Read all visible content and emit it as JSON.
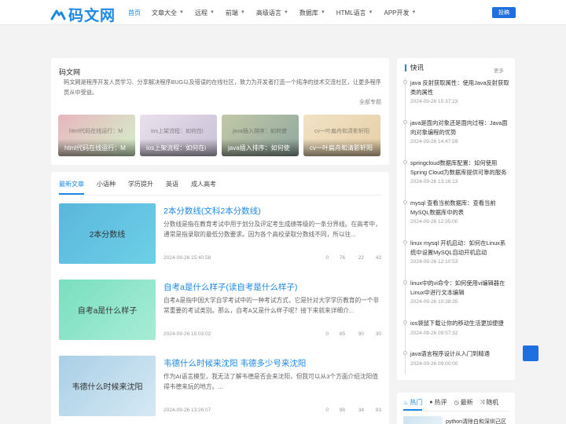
{
  "header": {
    "logo_text": "码文网",
    "nav": [
      {
        "label": "首页",
        "active": true,
        "dropdown": false
      },
      {
        "label": "文章大全",
        "active": false,
        "dropdown": true
      },
      {
        "label": "远程",
        "active": false,
        "dropdown": true
      },
      {
        "label": "前端",
        "active": false,
        "dropdown": true
      },
      {
        "label": "高级语言",
        "active": false,
        "dropdown": true
      },
      {
        "label": "数据库",
        "active": false,
        "dropdown": true
      },
      {
        "label": "HTML语言",
        "active": false,
        "dropdown": true
      },
      {
        "label": "APP开发",
        "active": false,
        "dropdown": true
      }
    ],
    "post_button": "投稿"
  },
  "intro": {
    "title": "码文网",
    "description": "码文网是程序开发人员学习、分享解决程序BUG以及错误的在线社区，致力为开发者打造一个纯净的技术交流社区，让更多程序员从中受益。",
    "all_topics": "全部专题",
    "thumbs": [
      {
        "watermark": "html代码在线运行：M",
        "caption": "html代码在线运行：M",
        "colors": [
          "#e8b6bf",
          "#d3f0c8"
        ]
      },
      {
        "watermark": "ios上架流程：如何在i",
        "caption": "ios上架流程：如何在i",
        "colors": [
          "#e9e1ec",
          "#c8c0d6"
        ]
      },
      {
        "watermark": "java插入排序：如何使",
        "caption": "java插入排序：如何使",
        "colors": [
          "#c2c8a6",
          "#8fa8a0"
        ]
      },
      {
        "watermark": "cv一叶扁舟和清影轩阳",
        "caption": "cv一叶扁舟和清影轩阳",
        "colors": [
          "#f1e2c4",
          "#e7cfa8"
        ]
      }
    ]
  },
  "articles": {
    "tabs": [
      {
        "label": "最新文章",
        "active": true
      },
      {
        "label": "小语种",
        "active": false
      },
      {
        "label": "学历提升",
        "active": false
      },
      {
        "label": "英语",
        "active": false
      },
      {
        "label": "成人高考",
        "active": false
      }
    ],
    "items": [
      {
        "image_text": "2本分数线",
        "title": "2本分数线(文科2本分数线)",
        "excerpt": "分数线是指在教育考试中用于划分及评定考生成绩等级的一条分界线。在高考中，通常是指录取的最低分数要求。因为各个高校录取分数线不同，所以往...",
        "date": "2024-09-26 15:40:58",
        "stats": [
          "0",
          "76",
          "22",
          "43"
        ],
        "colors": [
          "#5ab6dc",
          "#6ed0e6"
        ]
      },
      {
        "image_text": "自考a是什么样子",
        "title": "自考a是什么样子(读自考是什么样子)",
        "excerpt": "自考A是指中国大学自学考试中的一种考试方式，它是针对大学学历教育的一个非常重要的考试类别。那么，自考A又是什么样子呢？接下来就来详细介...",
        "date": "2024-09-26 15:03:02",
        "stats": [
          "0",
          "85",
          "90",
          "30"
        ],
        "colors": [
          "#79dfbf",
          "#a8ecd6"
        ]
      },
      {
        "image_text": "韦德什么时候来沈阳",
        "title": "韦德什么时候来沈阳 韦德多少号来沈阳",
        "excerpt": "作为AI语言模型，我无法了解韦德是否会来沈阳，但我可以从3个方面介绍沈阳值得韦德来玩的地方。...",
        "date": "2024-09-26 13:26:07",
        "stats": [
          "0",
          "98",
          "34",
          "93"
        ],
        "colors": [
          "#a9cfe6",
          "#d6e9f4"
        ]
      }
    ]
  },
  "news": {
    "title": "快讯",
    "more": "更多",
    "items": [
      {
        "title": "java 反射获取属性：使用Java反射获取类的属性",
        "date": "2024-09-26 15:37:23"
      },
      {
        "title": "java是面向对象还是面向过程：Java面向对象编程的优势",
        "date": "2024-09-26 14:47:59"
      },
      {
        "title": "springcloud数据库配置：如何使用Spring Cloud为数据库提供可靠的服务",
        "date": "2024-09-26 13:16:13"
      },
      {
        "title": "mysql 查看当前数据库：查看当前MySQL数据库中的表",
        "date": "2024-09-26 12:35:00"
      },
      {
        "title": "linux mysql 开机启动：如何在Linux系统中设置MySQL自动开机启动",
        "date": "2024-09-26 12:10:53"
      },
      {
        "title": "linux中的vi命令：如何使用vi编辑器在Linux中进行文本编辑",
        "date": "2024-09-26 10:38:35"
      },
      {
        "title": "ios袋鼠下载让你的移动生活更加便捷",
        "date": "2024-09-26 09:57:32"
      },
      {
        "title": "java语言程序设计从入门到精通",
        "date": "2024-09-26 09:00:00"
      }
    ]
  },
  "hot": {
    "tabs": [
      {
        "label": "热门",
        "icon": "fire-icon",
        "active": true
      },
      {
        "label": "热评",
        "icon": "comment-icon",
        "active": false
      },
      {
        "label": "最新",
        "icon": "clock-icon",
        "active": false
      },
      {
        "label": "随机",
        "icon": "shuffle-icon",
        "active": false
      }
    ],
    "first_title": "python清除白和深圳己区"
  },
  "colors": {
    "accent": "#1e88e5",
    "button": "#1e6fe0"
  }
}
